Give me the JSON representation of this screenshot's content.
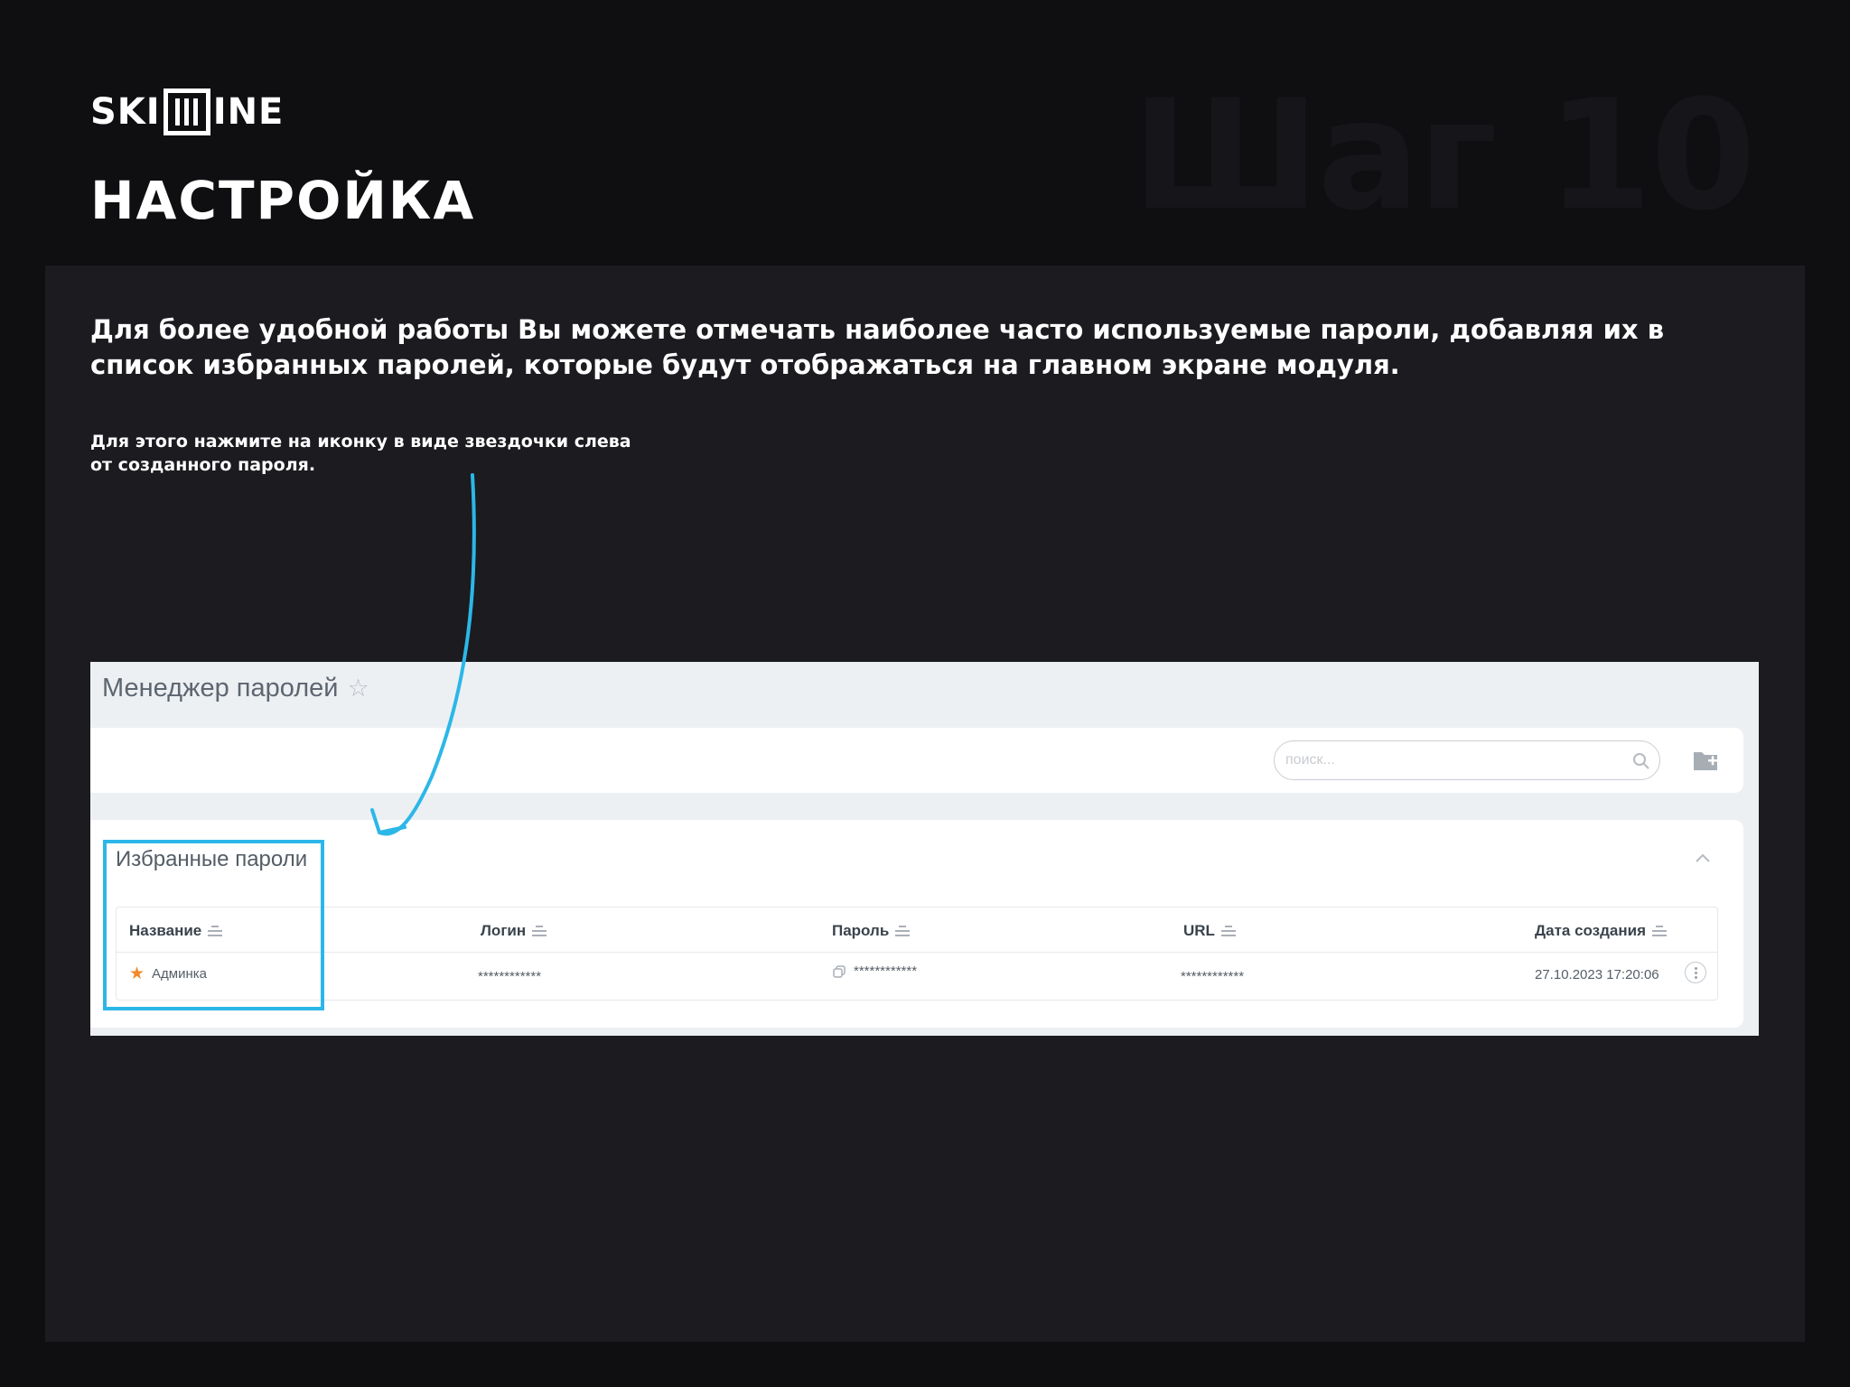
{
  "brand": {
    "logo_left": "SKI",
    "logo_right": "INE"
  },
  "slide": {
    "title": "НАСТРОЙКА",
    "step": "Шаг 10",
    "lead": "Для более удобной работы Вы можете отмечать наиболее часто используемые пароли, добавляя их в список избранных паролей, которые будут отображаться на главном экране модуля.",
    "hint": "Для этого нажмите на иконку в виде звездочки слева от созданного пароля."
  },
  "colors": {
    "accent": "#2cb7e8",
    "star": "#f08a2b",
    "step_watermark": "#16161a"
  },
  "app": {
    "title": "Менеджер паролей",
    "search_placeholder": "поиск...",
    "favorites": {
      "title": "Избранные пароли",
      "columns": [
        "Название",
        "Логин",
        "Пароль",
        "URL",
        "Дата создания"
      ],
      "rows": [
        {
          "name": "Админка",
          "login": "************",
          "password": "************",
          "url": "************",
          "created": "27.10.2023 17:20:06"
        }
      ]
    }
  },
  "icons": [
    "star-outline-icon",
    "search-icon",
    "folder-add-icon",
    "chevron-up-icon",
    "star-icon",
    "copy-icon",
    "more-icon",
    "arrow-icon"
  ]
}
